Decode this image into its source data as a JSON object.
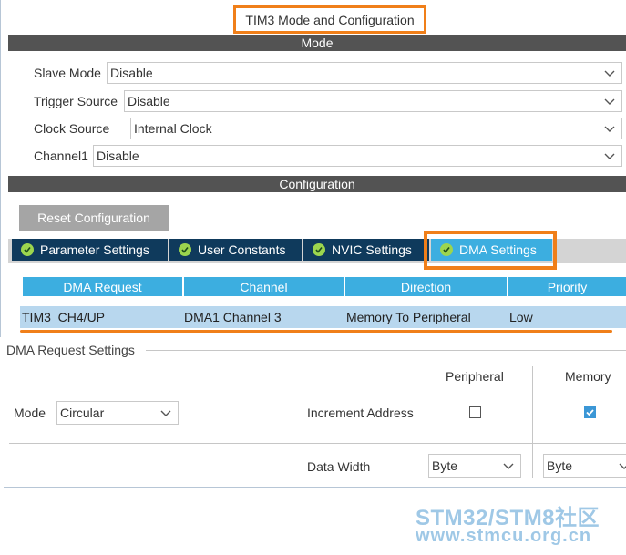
{
  "window": {
    "title": "TIM3 Mode and Configuration"
  },
  "mode_section": {
    "header": "Mode",
    "fields": [
      {
        "label": "Slave Mode",
        "value": "Disable"
      },
      {
        "label": "Trigger Source",
        "value": "Disable"
      },
      {
        "label": "Clock Source",
        "value": "Internal Clock"
      },
      {
        "label": "Channel1",
        "value": "Disable"
      }
    ]
  },
  "config_section": {
    "header": "Configuration",
    "reset_label": "Reset Configuration",
    "tabs": [
      {
        "label": "Parameter Settings",
        "icon": "check-circle-icon"
      },
      {
        "label": "User Constants",
        "icon": "check-circle-icon"
      },
      {
        "label": "NVIC Settings",
        "icon": "check-circle-icon"
      },
      {
        "label": "DMA Settings",
        "icon": "check-circle-icon",
        "active": true
      }
    ]
  },
  "dma_table": {
    "headers": [
      "DMA Request",
      "Channel",
      "Direction",
      "Priority"
    ],
    "rows": [
      [
        "TIM3_CH4/UP",
        "DMA1 Channel 3",
        "Memory To Peripheral",
        "Low"
      ]
    ]
  },
  "dma_request_settings": {
    "legend": "DMA Request Settings",
    "mode_label": "Mode",
    "mode_value": "Circular",
    "col_peripheral": "Peripheral",
    "col_memory": "Memory",
    "increment_label": "Increment Address",
    "increment_peripheral": false,
    "increment_memory": true,
    "data_width_label": "Data Width",
    "data_width_peripheral": "Byte",
    "data_width_memory": "Byte"
  },
  "watermark": {
    "line1": "STM32/STM8社区",
    "line2": "www.stmcu.org.cn"
  },
  "colors": {
    "highlight": "#f07f19",
    "section_bar": "#535353",
    "tab_bg": "#0f3a5c",
    "tab_active": "#3caee0",
    "row_selected": "#b8d7ee",
    "check": "#9cd54e"
  }
}
